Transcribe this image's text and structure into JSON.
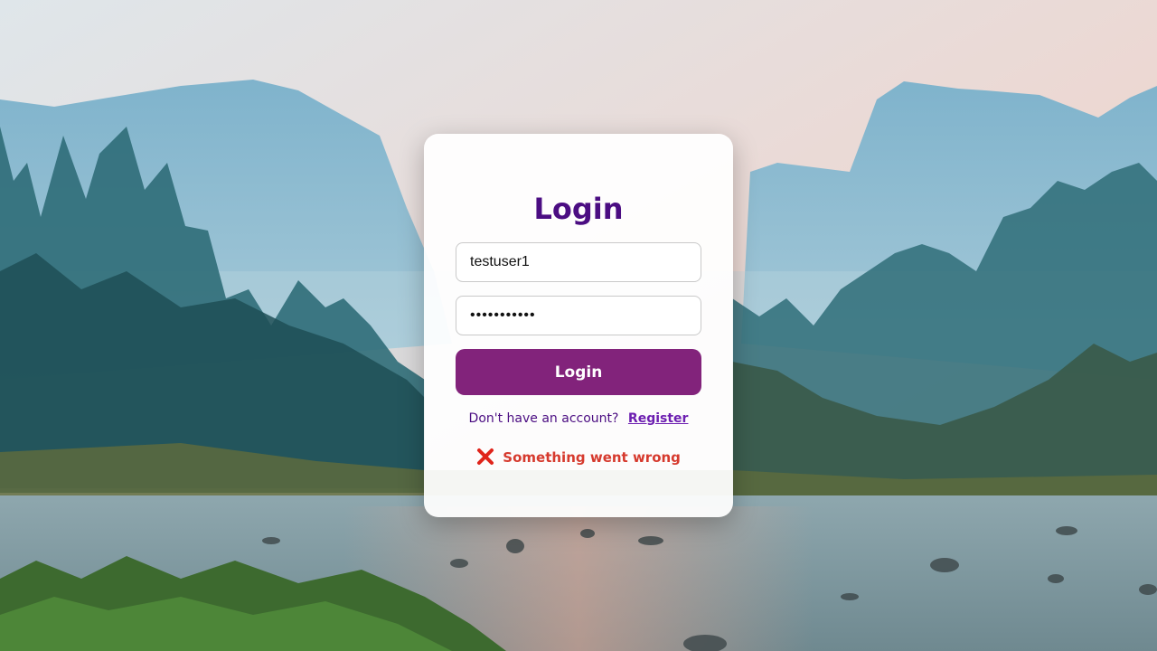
{
  "login": {
    "title": "Login",
    "username_value": "testuser1",
    "password_value": "•••••••••••",
    "submit_label": "Login",
    "no_account_text": "Don't have an account?",
    "register_link": "Register",
    "error_message": "Something went wrong"
  },
  "icons": {
    "error": "x-mark-icon"
  },
  "colors": {
    "title": "#4b0d82",
    "button": "#82237b",
    "link": "#6d1fb1",
    "error": "#d63a2e"
  }
}
